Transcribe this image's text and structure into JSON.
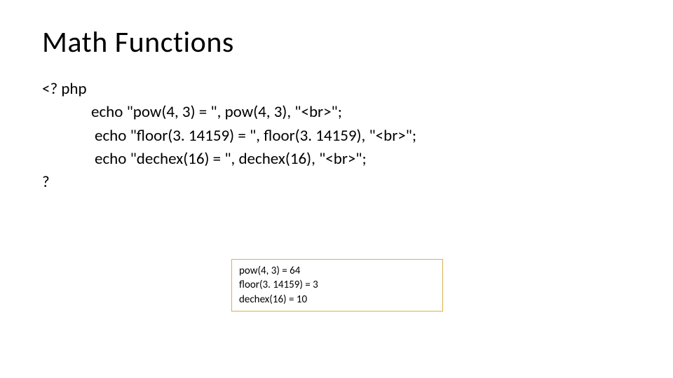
{
  "title": "Math Functions",
  "code": {
    "open": "<? php",
    "line1": "echo \"pow(4, 3) = \", pow(4, 3), \"<br>\";",
    "line2": "echo \"floor(3. 14159) = \", floor(3. 14159), \"<br>\";",
    "line3": "echo \"dechex(16) = \", dechex(16), \"<br>\";",
    "close": "?"
  },
  "output": {
    "line1": "pow(4, 3) = 64",
    "line2": "floor(3. 14159) = 3",
    "line3": "dechex(16) = 10"
  }
}
